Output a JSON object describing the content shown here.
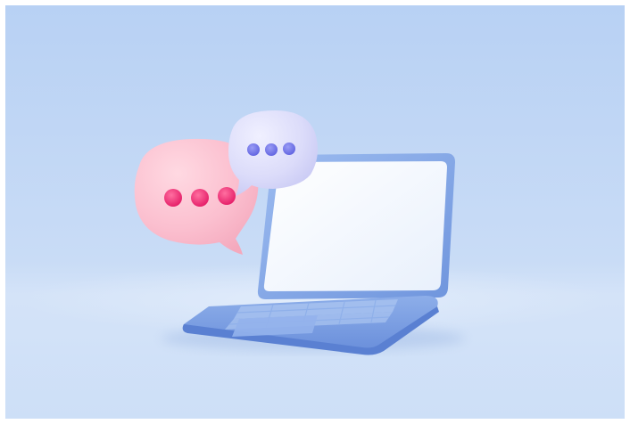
{
  "scene": {
    "subject": "laptop-with-chat-bubbles",
    "colors": {
      "background_top": "#b9d2f4",
      "background_mid": "#c6daf5",
      "floor": "#d3e3f8",
      "laptop_body": "#7fa4e6",
      "laptop_body_dark": "#5f86d6",
      "screen": "#f3f7fe",
      "pink_bubble": "#fcc0cf",
      "pink_dots": "#f0276f",
      "lilac_bubble": "#dcdcfa",
      "lilac_dots": "#7072e8"
    },
    "icons": [
      "speech-bubble-icon",
      "typing-dots-icon",
      "laptop-icon"
    ]
  }
}
